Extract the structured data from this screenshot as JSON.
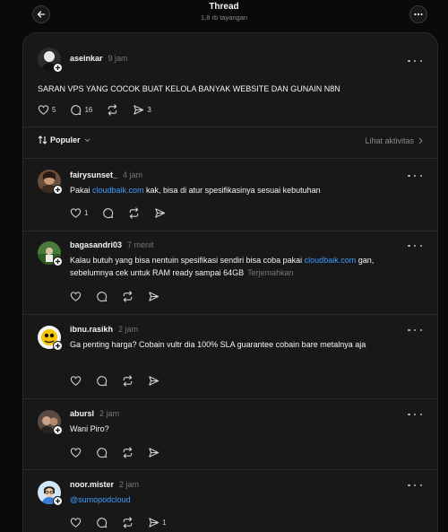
{
  "header": {
    "title": "Thread",
    "subtitle": "1,8 rb tayangan"
  },
  "main_post": {
    "username": "aseinkar",
    "time": "9 jam",
    "text": "SARAN VPS YANG COCOK BUAT KELOLA BANYAK WEBSITE DAN GUNAIN N8N",
    "likes": "5",
    "replies": "16",
    "shares": "3"
  },
  "sort": {
    "label": "Populer",
    "activity": "Lihat aktivitas"
  },
  "replies": [
    {
      "username": "fairysunset_",
      "time": "4 jam",
      "text_before": "Pakai ",
      "link": "cloudbaik.com",
      "text_after": " kak, bisa di atur spesifikasinya sesuai kebutuhan",
      "likes": "1"
    },
    {
      "username": "bagasandri03",
      "time": "7 menit",
      "text_before": "Kalau butuh yang bisa nentuin spesifikasi sendiri bisa coba pakai ",
      "link": "cloudbaik.com",
      "text_after": " gan, sebelumnya cek untuk RAM ready sampai 64GB",
      "translate": "Terjemahkan"
    },
    {
      "username": "ibnu.rasikh",
      "time": "2 jam",
      "text": "Ga penting harga? Cobain vultr dia 100% SLA guarantee cobain bare metalnya aja"
    },
    {
      "username": "abursl",
      "time": "2 jam",
      "text": "Wani Piro?"
    },
    {
      "username": "noor.mister",
      "time": "2 jam",
      "link": "@sumopodcloud",
      "shares": "1"
    }
  ],
  "colors": {
    "background": "#0a0a0a",
    "panel": "#181818",
    "text": "#f3f5f7",
    "muted": "#777777",
    "link": "#3e9cff"
  }
}
